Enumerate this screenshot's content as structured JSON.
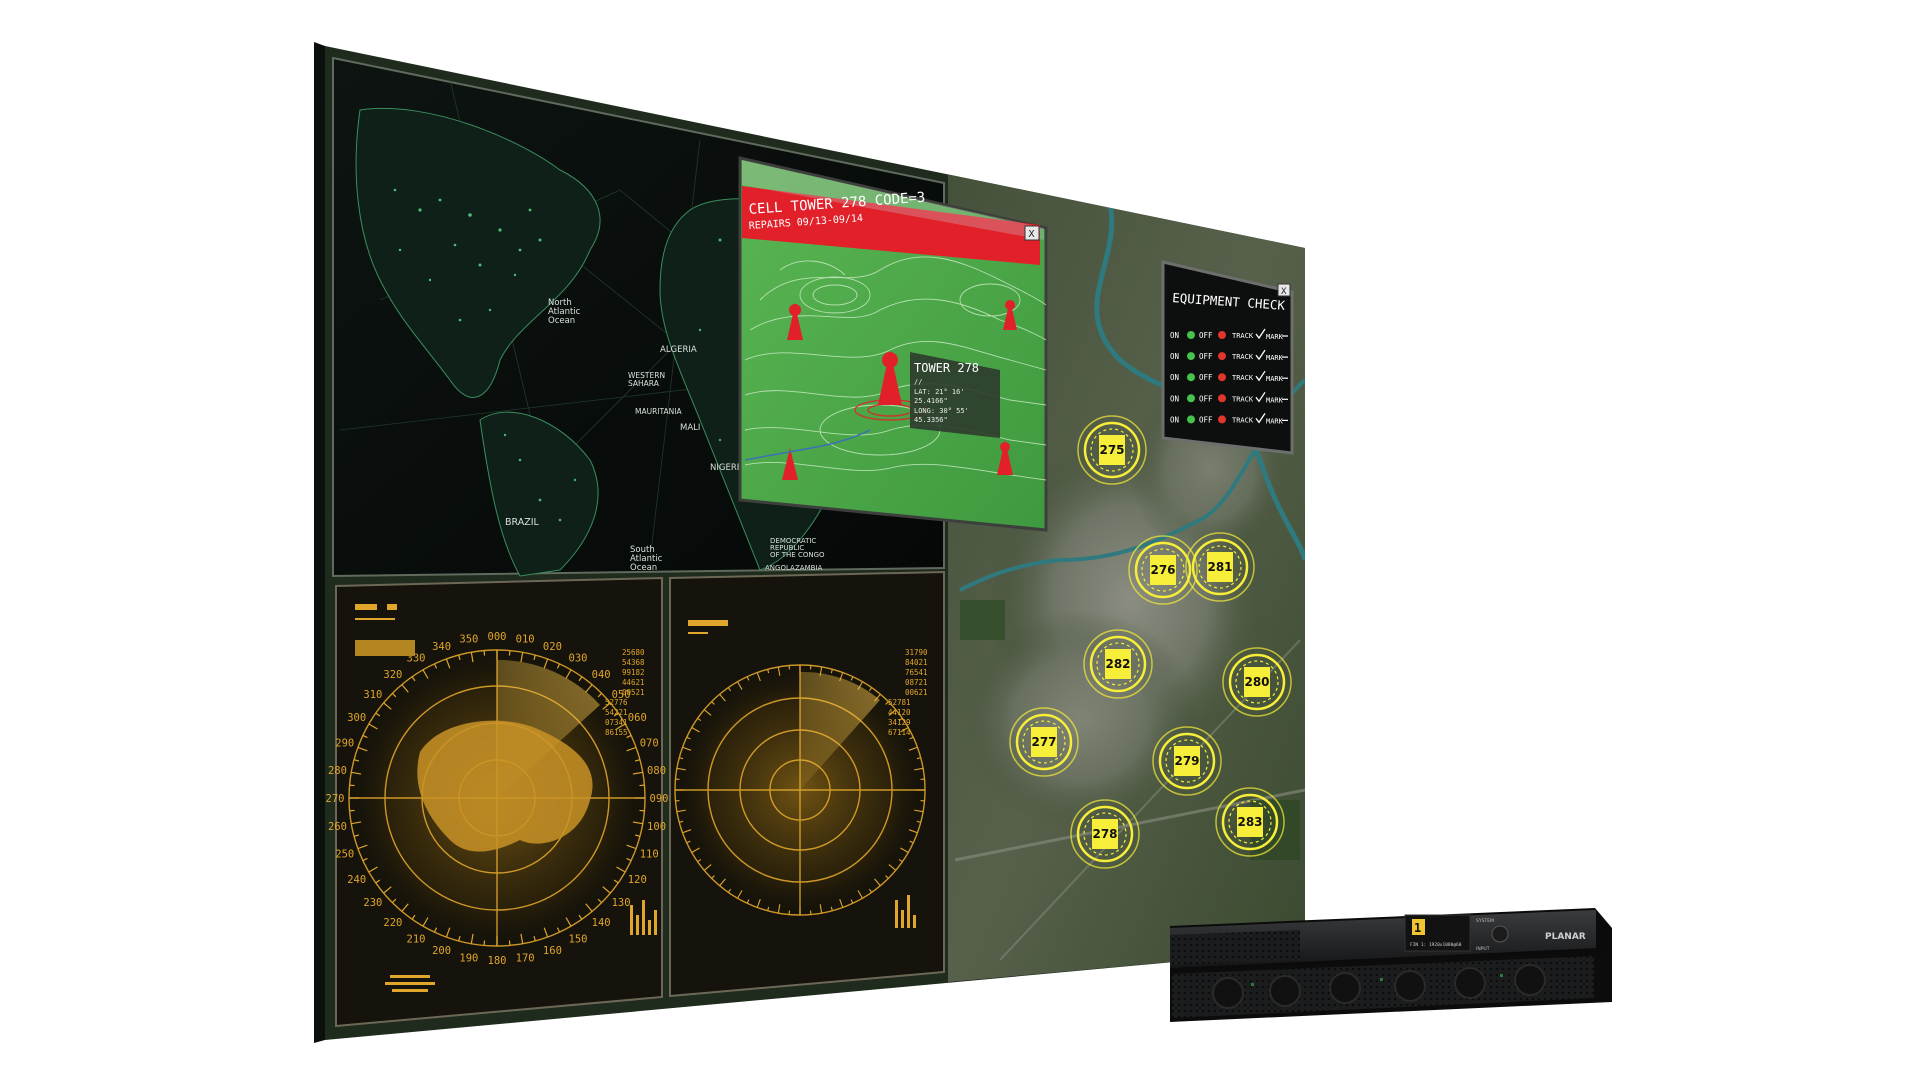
{
  "world_map": {
    "labels": [
      {
        "key": "na_ocean",
        "lines": [
          "North",
          "Atlantic",
          "Ocean"
        ]
      },
      {
        "key": "sa_ocean",
        "lines": [
          "South",
          "Atlantic",
          "Ocean"
        ]
      },
      {
        "key": "brazil",
        "lines": [
          "BRAZIL"
        ]
      },
      {
        "key": "algeria",
        "lines": [
          "ALGERIA"
        ]
      },
      {
        "key": "mali",
        "lines": [
          "MALI"
        ]
      },
      {
        "key": "nigeria",
        "lines": [
          "NIGERIA"
        ]
      },
      {
        "key": "mauritania",
        "lines": [
          "MAURITANIA"
        ]
      },
      {
        "key": "w_sahara",
        "lines": [
          "WESTERN",
          "SAHARA"
        ]
      },
      {
        "key": "drc",
        "lines": [
          "DEMOCRATIC",
          "REPUBLIC",
          "OF THE CONGO"
        ]
      },
      {
        "key": "angola",
        "lines": [
          "ANGOLA"
        ]
      },
      {
        "key": "zambia",
        "lines": [
          "ZAMBIA"
        ]
      }
    ]
  },
  "cell_tower_popup": {
    "title": "CELL TOWER 278 CODE=3",
    "subtitle": "REPAIRS 09/13-09/14",
    "close": "X",
    "info": {
      "name": "TOWER 278",
      "lines": [
        "//",
        "LAT: 21° 16'",
        "25.4166\"",
        "LONG: 30° 55'",
        "45.3356\""
      ]
    }
  },
  "equipment_check": {
    "title": "EQUIPMENT CHECK",
    "close": "X",
    "rows": [
      {
        "on": "ON",
        "off": "OFF",
        "track": "TRACK",
        "mark": "MARK"
      },
      {
        "on": "ON",
        "off": "OFF",
        "track": "TRACK",
        "mark": "MARK"
      },
      {
        "on": "ON",
        "off": "OFF",
        "track": "TRACK",
        "mark": "MARK"
      },
      {
        "on": "ON",
        "off": "OFF",
        "track": "TRACK",
        "mark": "MARK"
      },
      {
        "on": "ON",
        "off": "OFF",
        "track": "TRACK",
        "mark": "MARK"
      }
    ],
    "colors": {
      "on": "#46c34a",
      "off": "#e2352b"
    }
  },
  "tower_markers": [
    "275",
    "276",
    "281",
    "282",
    "280",
    "277",
    "279",
    "278",
    "283"
  ],
  "radar_left": {
    "degrees": [
      "350",
      "000",
      "010",
      "340",
      "020",
      "330",
      "030",
      "320",
      "040",
      "310",
      "050",
      "300",
      "060",
      "290",
      "070",
      "280",
      "080",
      "270",
      "090",
      "260",
      "100",
      "250",
      "110",
      "240",
      "120",
      "230",
      "130",
      "220",
      "140",
      "210",
      "150",
      "200",
      "160",
      "190",
      "180",
      "170"
    ],
    "readout": [
      "25680",
      "54368",
      "99182",
      "44621",
      "09521",
      "52776",
      "54221",
      "07341",
      "86155"
    ]
  },
  "radar_right": {
    "readout": [
      "31790",
      "84021",
      "76541",
      "08721",
      "00621",
      "52781",
      "44120",
      "34129",
      "67114"
    ]
  },
  "hardware": {
    "brand": "PLANAR",
    "display_number": "1",
    "display_text": "FIN 1: 1920x1080@60",
    "label_top": "SYSTEM",
    "label_bottom": "INPUT"
  },
  "colors": {
    "frame": "#1f2b1d",
    "radar": "#e0a52b",
    "alert_red": "#e1202a",
    "marker_yellow": "#f6ee38",
    "map_green": "#56b84e"
  }
}
